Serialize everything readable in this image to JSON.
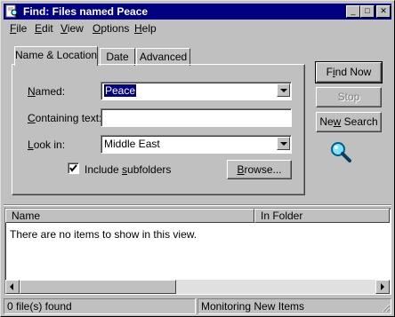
{
  "window": {
    "title": "Find: Files named Peace"
  },
  "titlebar_buttons": {
    "minimize": "_",
    "maximize": "□",
    "close": "✕"
  },
  "menu": [
    {
      "accel": "F",
      "rest": "ile"
    },
    {
      "accel": "E",
      "rest": "dit"
    },
    {
      "accel": "V",
      "rest": "iew"
    },
    {
      "accel": "O",
      "rest": "ptions"
    },
    {
      "accel": "H",
      "rest": "elp"
    }
  ],
  "tabs": {
    "name_location": "Name & Location",
    "date": "Date",
    "advanced": "Advanced"
  },
  "form": {
    "named": {
      "label_accel": "N",
      "label_rest": "amed:",
      "value": "Peace"
    },
    "containing": {
      "label_accel": "C",
      "label_rest": "ontaining text:",
      "value": ""
    },
    "look_in": {
      "label_accel": "L",
      "label_rest": "ook in:",
      "value": "Middle East"
    },
    "include_subfolders": {
      "label_pre": "Include ",
      "label_accel": "s",
      "label_rest": "ubfolders",
      "checked": true
    },
    "browse": {
      "label_accel": "B",
      "label_rest": "rowse..."
    }
  },
  "buttons": {
    "find_now": {
      "label_pre": "F",
      "label_accel": "i",
      "label_rest": "nd Now"
    },
    "stop": {
      "label": "Stop"
    },
    "new_search": {
      "label_pre": "Ne",
      "label_accel": "w",
      "label_rest": " Search"
    }
  },
  "results": {
    "columns": [
      "Name",
      "In Folder"
    ],
    "empty_message": "There are no items to show in this view."
  },
  "status": {
    "count": "0 file(s) found",
    "monitoring": "Monitoring New Items"
  },
  "icons": {
    "title": "find-icon",
    "search_animation": "magnifier-icon"
  },
  "colors": {
    "titlebar": "#000080",
    "face": "#c0c0c0",
    "selection": "#000080"
  }
}
